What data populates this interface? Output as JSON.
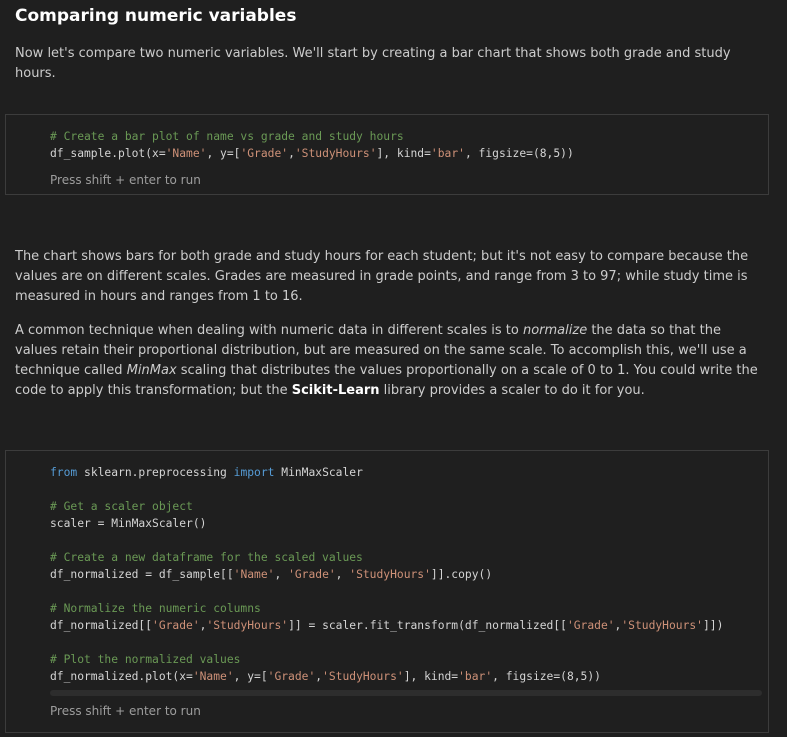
{
  "heading": "Comparing numeric variables",
  "intro": "Now let's compare two numeric variables. We'll start by creating a bar chart that shows both grade and study hours.",
  "cell1": {
    "comment": "# Create a bar plot of name vs grade and study hours",
    "l2_a": "df_sample.plot(x=",
    "l2_s1": "'Name'",
    "l2_b": ", y=[",
    "l2_s2": "'Grade'",
    "l2_c": ",",
    "l2_s3": "'StudyHours'",
    "l2_d": "], kind=",
    "l2_s4": "'bar'",
    "l2_e": ", figsize=(8,5))",
    "hint": "Press shift + enter to run"
  },
  "para2": "The chart shows bars for both grade and study hours for each student; but it's not easy to compare because the values are on different scales. Grades are measured in grade points, and range from 3 to 97; while study time is measured in hours and ranges from 1 to 16.",
  "para3": {
    "a": "A common technique when dealing with numeric data in different scales is to ",
    "em1": "normalize",
    "b": " the data so that the values retain their proportional distribution, but are measured on the same scale. To accomplish this, we'll use a technique called ",
    "em2": "MinMax",
    "c": " scaling that distributes the values proportionally on a scale of 0 to 1. You could write the code to apply this transformation; but the ",
    "strong": "Scikit-Learn",
    "d": " library provides a scaler to do it for you."
  },
  "cell2": {
    "l1_kw1": "from",
    "l1_mod": " sklearn.preprocessing ",
    "l1_kw2": "import",
    "l1_name": " MinMaxScaler",
    "c1": "# Get a scaler object",
    "l2": "scaler = MinMaxScaler()",
    "c2": "# Create a new dataframe for the scaled values",
    "l3_a": "df_normalized = df_sample[[",
    "l3_s1": "'Name'",
    "l3_b": ", ",
    "l3_s2": "'Grade'",
    "l3_c": ", ",
    "l3_s3": "'StudyHours'",
    "l3_d": "]].copy()",
    "c3": "# Normalize the numeric columns",
    "l4_a": "df_normalized[[",
    "l4_s1": "'Grade'",
    "l4_b": ",",
    "l4_s2": "'StudyHours'",
    "l4_c": "]] = scaler.fit_transform(df_normalized[[",
    "l4_s3": "'Grade'",
    "l4_d": ",",
    "l4_s4": "'StudyHours'",
    "l4_e": "]])",
    "c4": "# Plot the normalized values",
    "l5_a": "df_normalized.plot(x=",
    "l5_s1": "'Name'",
    "l5_b": ", y=[",
    "l5_s2": "'Grade'",
    "l5_c": ",",
    "l5_s3": "'StudyHours'",
    "l5_d": "], kind=",
    "l5_s4": "'bar'",
    "l5_e": ", figsize=(8,5))",
    "hint": "Press shift + enter to run"
  },
  "colors": {
    "background": "#1f1f1f",
    "comment": "#6a9955",
    "keyword": "#569cd6",
    "string": "#ce9178"
  }
}
